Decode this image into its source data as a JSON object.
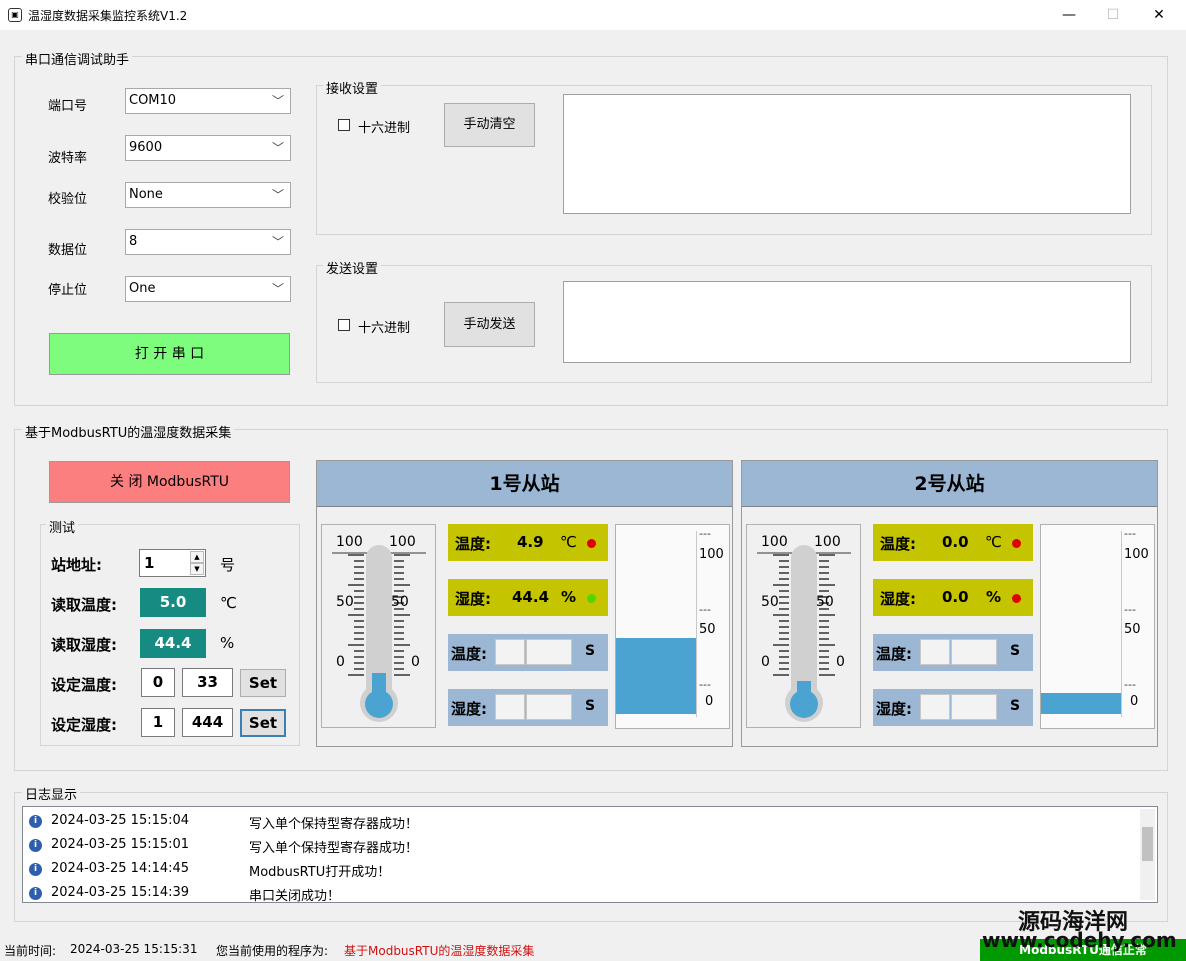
{
  "window": {
    "title": "温湿度数据采集监控系统V1.2",
    "icon_glyph": "▣",
    "minimize_glyph": "—",
    "maximize_glyph": "☐",
    "close_glyph": "✕"
  },
  "serial": {
    "group_title": "串口通信调试助手",
    "port_label": "端口号",
    "port_value": "COM10",
    "baud_label": "波特率",
    "baud_value": "9600",
    "parity_label": "校验位",
    "parity_value": "None",
    "databits_label": "数据位",
    "databits_value": "8",
    "stopbits_label": "停止位",
    "stopbits_value": "One",
    "dropdown_glyph": "﹀",
    "open_button": "打 开 串 口",
    "receive": {
      "title": "接收设置",
      "hex_label": "十六进制",
      "clear_button": "手动清空"
    },
    "send": {
      "title": "发送设置",
      "hex_label": "十六进制",
      "send_button": "手动发送"
    }
  },
  "modbus": {
    "group_title": "基于ModbusRTU的温湿度数据采集",
    "close_button": "关 闭 ModbusRTU",
    "test": {
      "title": "测试",
      "addr_label": "站地址:",
      "addr_value": "1",
      "addr_unit": "号",
      "spin_up": "▲",
      "spin_down": "▼",
      "read_temp_label": "读取温度:",
      "read_temp_value": "5.0",
      "read_temp_unit": "℃",
      "read_hum_label": "读取湿度:",
      "read_hum_value": "44.4",
      "read_hum_unit": "%",
      "set_temp_label": "设定温度:",
      "set_temp_a": "0",
      "set_temp_b": "33",
      "set_hum_label": "设定湿度:",
      "set_hum_a": "1",
      "set_hum_b": "444",
      "set_button": "Set"
    },
    "stations": [
      {
        "title": "1号从站",
        "thermo": {
          "scale_top": "100",
          "scale_mid": "50",
          "scale_bot": "0",
          "level_fraction": 0.049
        },
        "temp_label": "温度:",
        "temp_value": "4.9",
        "temp_unit": "℃",
        "temp_dot": "#e00000",
        "hum_label": "湿度:",
        "hum_value": "44.4",
        "hum_unit": "%",
        "hum_dot": "#55d400",
        "set_temp_label": "温度:",
        "set_temp_unit": "S",
        "set_hum_label": "湿度:",
        "set_hum_unit": "S",
        "tank": {
          "tick_top": "100",
          "tick_mid": "50",
          "tick_bot": "0",
          "level_fraction": 0.444
        }
      },
      {
        "title": "2号从站",
        "thermo": {
          "scale_top": "100",
          "scale_mid": "50",
          "scale_bot": "0",
          "level_fraction": 0.0
        },
        "temp_label": "温度:",
        "temp_value": "0.0",
        "temp_unit": "℃",
        "temp_dot": "#e00000",
        "hum_label": "湿度:",
        "hum_value": "0.0",
        "hum_unit": "%",
        "hum_dot": "#e00000",
        "set_temp_label": "温度:",
        "set_temp_unit": "S",
        "set_hum_label": "湿度:",
        "set_hum_unit": "S",
        "tank": {
          "tick_top": "100",
          "tick_mid": "50",
          "tick_bot": "0",
          "level_fraction": 0.12
        }
      }
    ]
  },
  "log": {
    "group_title": "日志显示",
    "info_glyph": "i",
    "rows": [
      {
        "time": "2024-03-25 15:15:04",
        "msg": "写入单个保持型寄存器成功！"
      },
      {
        "time": "2024-03-25 15:15:01",
        "msg": "写入单个保持型寄存器成功！"
      },
      {
        "time": "2024-03-25 14:14:45",
        "msg": "ModbusRTU打开成功！"
      },
      {
        "time": "2024-03-25 15:14:39",
        "msg": "串口关闭成功！"
      }
    ]
  },
  "status": {
    "time_label": "当前时间:",
    "time_value": "2024-03-25 15:15:31",
    "program_label": "您当前使用的程序为:",
    "program_value": "基于ModbusRTU的温湿度数据采集",
    "comm_status": "ModbusRTU通信正常",
    "watermark_1": "源码海洋网",
    "watermark_2": "www.codehy.com"
  },
  "colors": {
    "open_button": "#7dfc7d",
    "close_button": "#fc7f7f",
    "teal": "#158b82",
    "header_blue": "#9bb7d4",
    "olive": "#c4c400",
    "water": "#4aa3d0",
    "status_red": "#d01010",
    "status_green": "#009900"
  }
}
